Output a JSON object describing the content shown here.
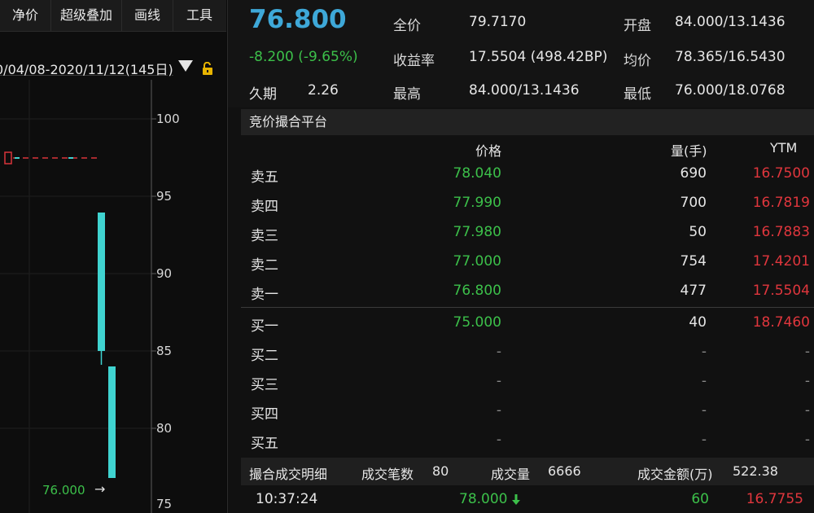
{
  "toolbar": {
    "items": [
      "净价",
      "超级叠加",
      "画线",
      "工具"
    ]
  },
  "chart": {
    "date_range": "0/04/08-2020/11/12(145日)",
    "y_ticks": [
      "100",
      "95",
      "90",
      "85",
      "80",
      "75"
    ],
    "last_price_label": "76.000",
    "arrow": "→"
  },
  "quote": {
    "price": "76.800",
    "change": "-8.200 (-9.65%)",
    "duration_label": "久期",
    "duration_value": "2.26",
    "full_price_label": "全价",
    "full_price_value": "79.7170",
    "yield_label": "收益率",
    "yield_value": "17.5504 (498.42BP)",
    "high_label": "最高",
    "high_value": "84.000/13.1436",
    "open_label": "开盘",
    "open_value": "84.000/13.1436",
    "avg_label": "均价",
    "avg_value": "78.365/16.5430",
    "low_label": "最低",
    "low_value": "76.000/18.0768"
  },
  "orderbook": {
    "title": "竞价撮合平台",
    "headers": {
      "price": "价格",
      "volume": "量(手)",
      "ytm": "YTM"
    },
    "rows": [
      {
        "label": "卖五",
        "price": "78.040",
        "volume": "690",
        "ytm": "16.7500"
      },
      {
        "label": "卖四",
        "price": "77.990",
        "volume": "700",
        "ytm": "16.7819"
      },
      {
        "label": "卖三",
        "price": "77.980",
        "volume": "50",
        "ytm": "16.7883"
      },
      {
        "label": "卖二",
        "price": "77.000",
        "volume": "754",
        "ytm": "17.4201"
      },
      {
        "label": "卖一",
        "price": "76.800",
        "volume": "477",
        "ytm": "17.5504"
      },
      {
        "label": "买一",
        "price": "75.000",
        "volume": "40",
        "ytm": "18.7460"
      },
      {
        "label": "买二",
        "price": "-",
        "volume": "-",
        "ytm": "-"
      },
      {
        "label": "买三",
        "price": "-",
        "volume": "-",
        "ytm": "-"
      },
      {
        "label": "买四",
        "price": "-",
        "volume": "-",
        "ytm": "-"
      },
      {
        "label": "买五",
        "price": "-",
        "volume": "-",
        "ytm": "-"
      }
    ]
  },
  "trades": {
    "title": "撮合成交明细",
    "count_label": "成交笔数",
    "count_value": "80",
    "volume_label": "成交量",
    "volume_value": "6666",
    "amount_label": "成交金额(万)",
    "amount_value": "522.38",
    "last": {
      "time": "10:37:24",
      "price": "78.000",
      "direction_icon": "down-arrow",
      "volume": "60",
      "ytm": "16.7755"
    }
  },
  "colors": {
    "accent": "#3ea8d8",
    "up": "#e0363d",
    "down": "#3cc04a",
    "candle": "#3fd3d0"
  }
}
